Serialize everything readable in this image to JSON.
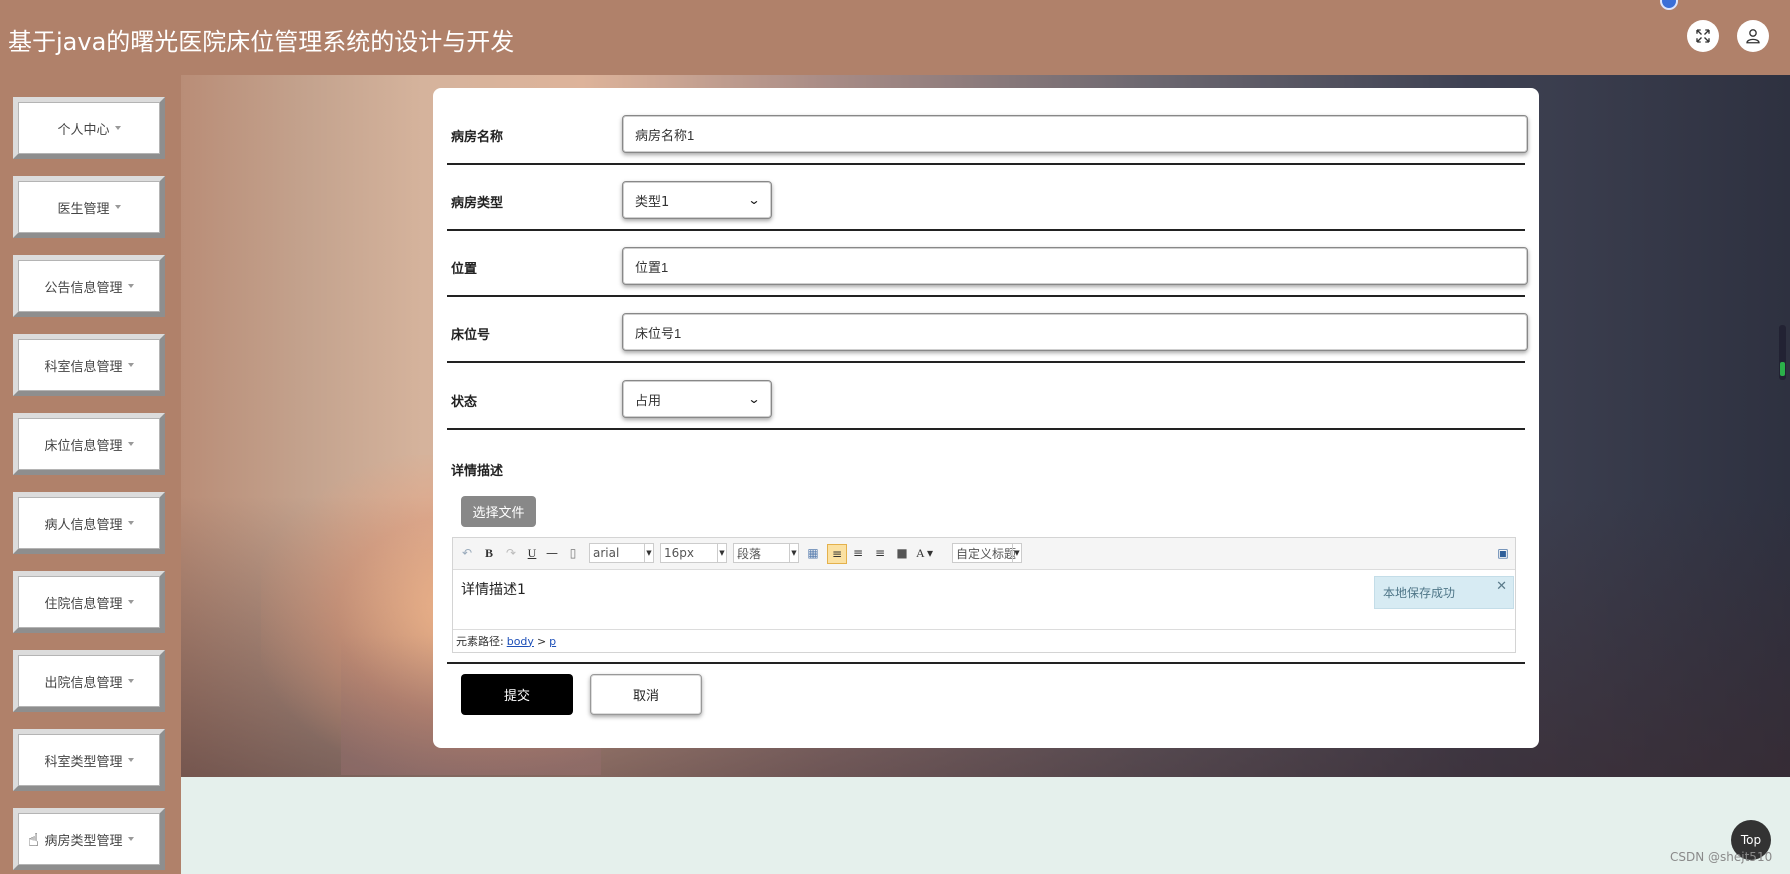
{
  "header": {
    "title": "基于java的曙光医院床位管理系统的设计与开发",
    "fullscreen_icon": "fullscreen-icon",
    "user_icon": "user-icon"
  },
  "sidebar": {
    "items": [
      {
        "label": "个人中心"
      },
      {
        "label": "医生管理"
      },
      {
        "label": "公告信息管理"
      },
      {
        "label": "科室信息管理"
      },
      {
        "label": "床位信息管理"
      },
      {
        "label": "病人信息管理"
      },
      {
        "label": "住院信息管理"
      },
      {
        "label": "出院信息管理"
      },
      {
        "label": "科室类型管理"
      },
      {
        "label": "病房类型管理"
      }
    ]
  },
  "form": {
    "ward_name": {
      "label": "病房名称",
      "value": "病房名称1"
    },
    "ward_type": {
      "label": "病房类型",
      "value": "类型1"
    },
    "location": {
      "label": "位置",
      "value": "位置1"
    },
    "bed_number": {
      "label": "床位号",
      "value": "床位号1"
    },
    "status": {
      "label": "状态",
      "value": "占用"
    },
    "description": {
      "label": "详情描述"
    },
    "upload_label": "选择文件",
    "submit_label": "提交",
    "cancel_label": "取消"
  },
  "editor": {
    "font_family": "arial",
    "font_size": "16px",
    "paragraph": "段落",
    "custom_heading": "自定义标题",
    "content": "详情描述1",
    "toast": "本地保存成功",
    "status_label": "元素路径:",
    "path_body": "body",
    "path_sep": ">",
    "path_p": "p"
  },
  "footer": {
    "top_label": "Top",
    "watermark": "CSDN @shejt510"
  },
  "colors": {
    "header_bg": "#b0816a",
    "submit_bg": "#000000",
    "toast_bg": "#d7ebf3"
  }
}
